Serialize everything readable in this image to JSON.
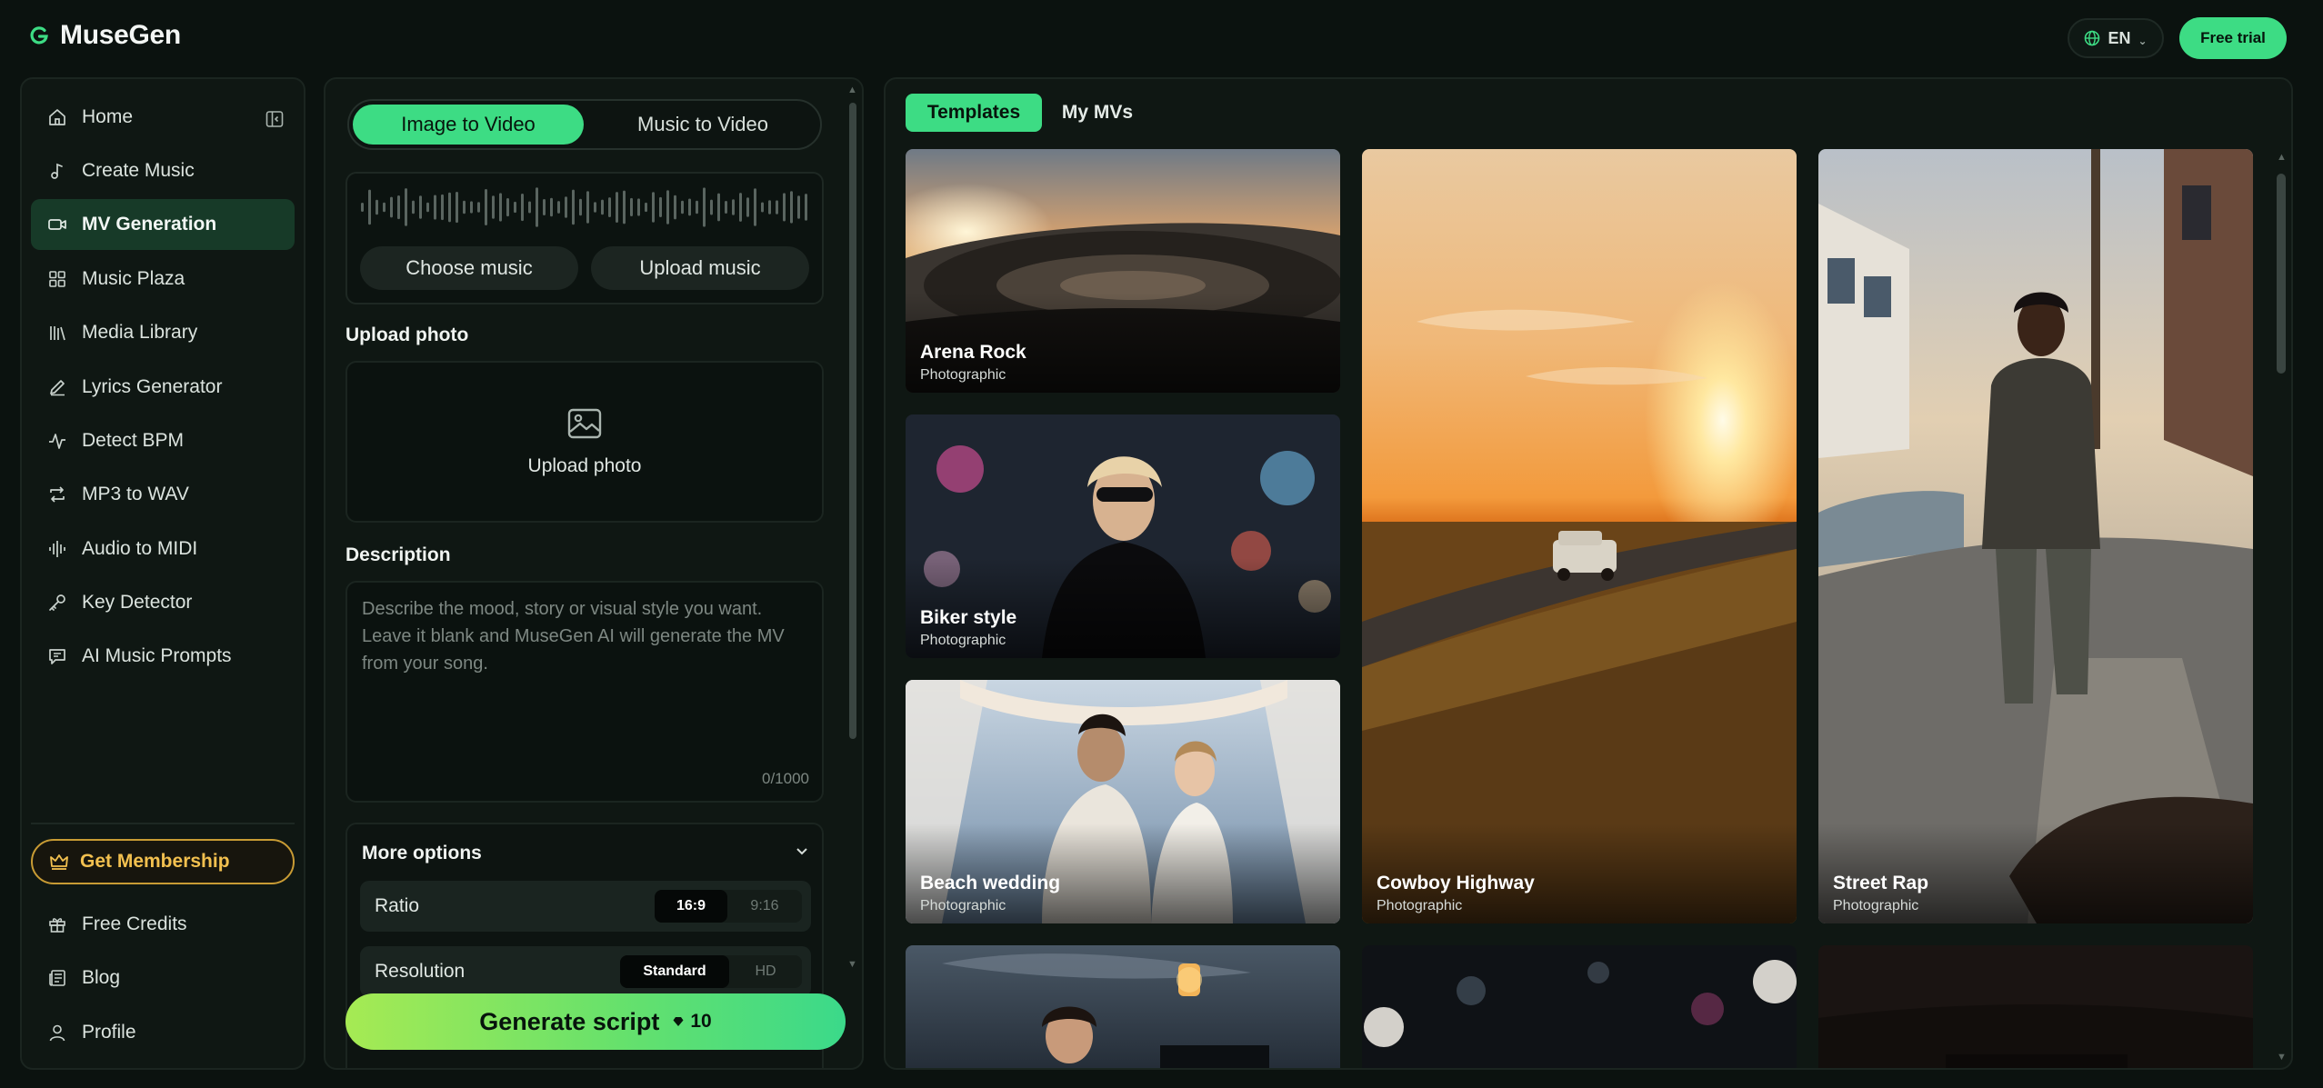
{
  "app": {
    "name": "MuseGen",
    "language": "EN",
    "free_trial_label": "Free trial",
    "brand_color": "#3ddc84"
  },
  "sidebar": {
    "items": [
      {
        "label": "Home",
        "icon": "home-icon"
      },
      {
        "label": "Create Music",
        "icon": "music-note-icon"
      },
      {
        "label": "MV Generation",
        "icon": "video-camera-icon",
        "active": true
      },
      {
        "label": "Music Plaza",
        "icon": "grid-icon"
      },
      {
        "label": "Media Library",
        "icon": "library-icon"
      },
      {
        "label": "Lyrics Generator",
        "icon": "pen-icon"
      },
      {
        "label": "Detect BPM",
        "icon": "pulse-icon"
      },
      {
        "label": "MP3 to WAV",
        "icon": "convert-icon"
      },
      {
        "label": "Audio to MIDI",
        "icon": "audio-bars-icon"
      },
      {
        "label": "Key Detector",
        "icon": "key-icon"
      },
      {
        "label": "AI Music Prompts",
        "icon": "chat-icon"
      }
    ],
    "membership_label": "Get Membership",
    "bottom_items": [
      {
        "label": "Free Credits",
        "icon": "gift-icon"
      },
      {
        "label": "Blog",
        "icon": "newspaper-icon"
      },
      {
        "label": "Profile",
        "icon": "user-icon"
      }
    ]
  },
  "generator": {
    "modes": [
      "Image to Video",
      "Music to Video"
    ],
    "active_mode": "Image to Video",
    "choose_music_label": "Choose music",
    "upload_music_label": "Upload music",
    "upload_photo_heading": "Upload photo",
    "upload_photo_label": "Upload photo",
    "description_heading": "Description",
    "description_placeholder": "Describe the mood, story or visual style you want. Leave it blank and MuseGen AI will generate the MV from your song.",
    "char_count": "0/1000",
    "more_options_label": "More options",
    "options": {
      "ratio": {
        "label": "Ratio",
        "choices": [
          "16:9",
          "9:16"
        ],
        "selected": "16:9"
      },
      "resolution": {
        "label": "Resolution",
        "choices": [
          "Standard",
          "HD"
        ],
        "selected": "Standard"
      }
    },
    "generate_label": "Generate script",
    "generate_cost": "10"
  },
  "gallery": {
    "tabs": [
      "Templates",
      "My MVs"
    ],
    "active_tab": "Templates",
    "templates": [
      {
        "title": "Arena Rock",
        "style": "Photographic"
      },
      {
        "title": "Biker style",
        "style": "Photographic"
      },
      {
        "title": "Beach wedding",
        "style": "Photographic"
      },
      {
        "title": "Cowboy Highway",
        "style": "Photographic"
      },
      {
        "title": "Street Rap",
        "style": "Photographic"
      }
    ]
  }
}
